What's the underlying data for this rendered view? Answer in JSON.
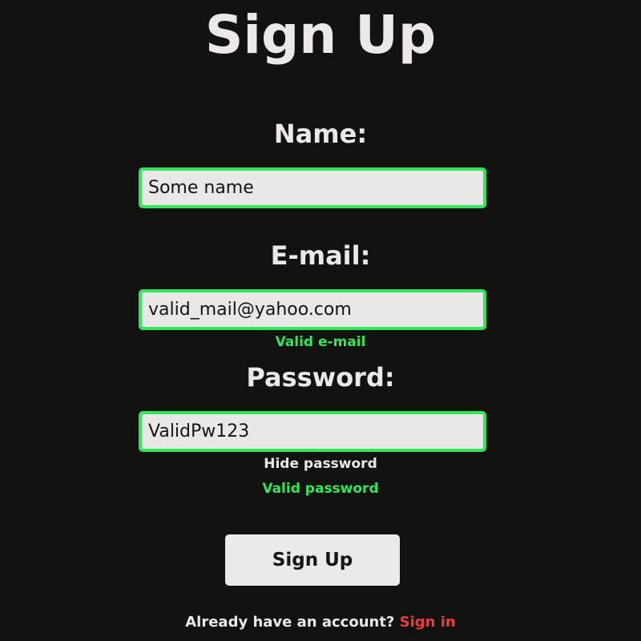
{
  "title": "Sign Up",
  "name": {
    "label": "Name:",
    "value": "Some name"
  },
  "email": {
    "label": "E-mail:",
    "value": "valid_mail@yahoo.com",
    "validation": "Valid e-mail"
  },
  "password": {
    "label": "Password:",
    "value": "ValidPw123",
    "toggle_label": "Hide password",
    "validation": "Valid password"
  },
  "submit_label": "Sign Up",
  "footer": {
    "prompt": "Already have an account?",
    "link_label": "Sign in"
  },
  "colors": {
    "background": "#121310",
    "valid_border": "#2ee85a",
    "link": "#ea3c3c"
  }
}
